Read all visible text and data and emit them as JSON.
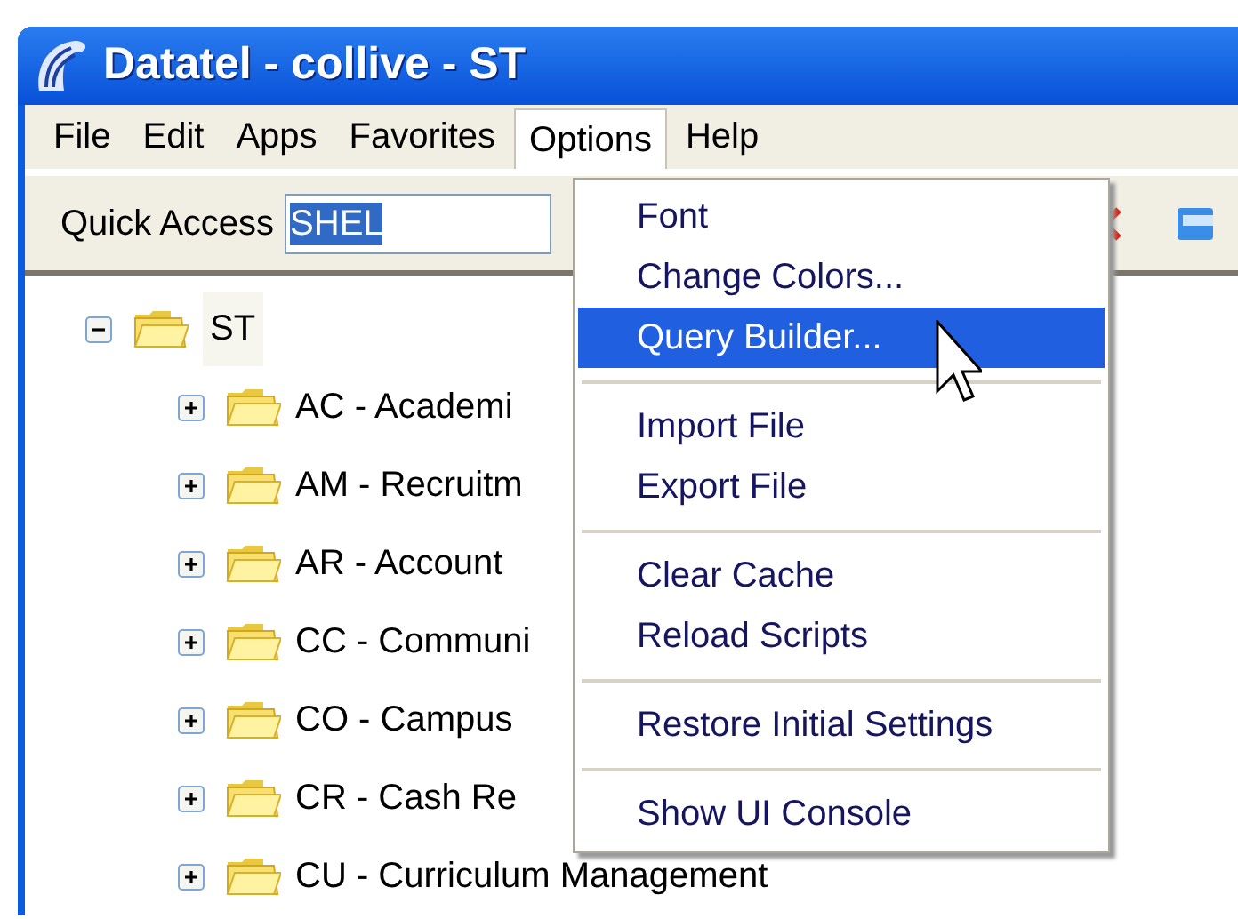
{
  "window": {
    "title": "Datatel - collive - ST"
  },
  "menu_bar": [
    {
      "label": "File",
      "selected": false
    },
    {
      "label": "Edit",
      "selected": false
    },
    {
      "label": "Apps",
      "selected": false
    },
    {
      "label": "Favorites",
      "selected": false
    },
    {
      "label": "Options",
      "selected": true
    },
    {
      "label": "Help",
      "selected": false
    }
  ],
  "quick_access": {
    "label": "Quick Access",
    "value": "SHEL"
  },
  "tree": {
    "label": "ST",
    "expanded": true,
    "children": [
      {
        "label": "AC - Academi",
        "expanded": false
      },
      {
        "label": "AM - Recruitm",
        "expanded": false
      },
      {
        "label": "AR - Account",
        "expanded": false
      },
      {
        "label": "CC - Communi",
        "expanded": false
      },
      {
        "label": "CO - Campus",
        "expanded": false
      },
      {
        "label": "CR - Cash Re",
        "expanded": false
      },
      {
        "label": "CU - Curriculum Management",
        "expanded": false
      }
    ]
  },
  "options_menu": [
    [
      {
        "label": "Font",
        "selected": false
      },
      {
        "label": "Change Colors...",
        "selected": false
      },
      {
        "label": "Query Builder...",
        "selected": true
      }
    ],
    [
      {
        "label": "Import File",
        "selected": false
      },
      {
        "label": "Export File",
        "selected": false
      }
    ],
    [
      {
        "label": "Clear Cache",
        "selected": false
      },
      {
        "label": "Reload Scripts",
        "selected": false
      }
    ],
    [
      {
        "label": "Restore Initial Settings",
        "selected": false
      }
    ],
    [
      {
        "label": "Show UI Console",
        "selected": false
      }
    ]
  ]
}
